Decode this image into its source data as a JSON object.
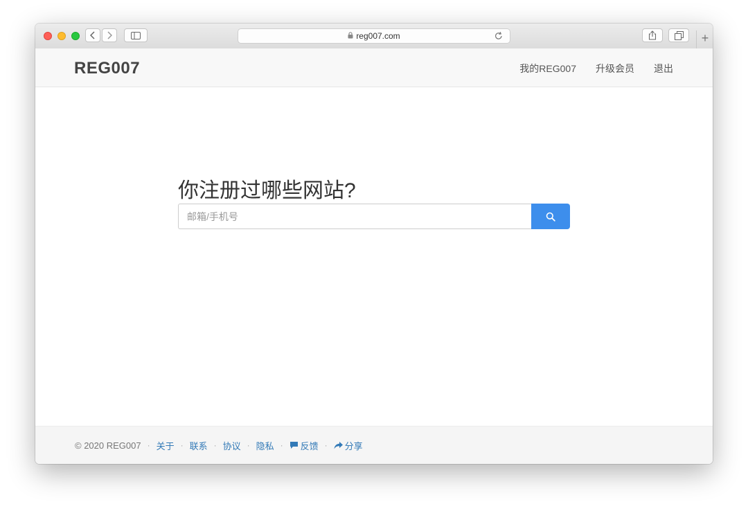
{
  "browser": {
    "url": "reg007.com",
    "icons": [
      "back-icon",
      "forward-icon",
      "sidebar-icon",
      "lock-icon",
      "reload-icon",
      "share-icon",
      "tabs-icon",
      "new-tab-icon"
    ],
    "new_tab_label": "+"
  },
  "header": {
    "logo": "REG007",
    "nav": [
      {
        "label": "我的REG007"
      },
      {
        "label": "升级会员"
      },
      {
        "label": "退出"
      }
    ]
  },
  "main": {
    "headline": "你注册过哪些网站?",
    "search": {
      "placeholder": "邮箱/手机号",
      "value": "",
      "button_icon": "search-icon"
    }
  },
  "footer": {
    "copyright": "© 2020 REG007",
    "separator": "·",
    "links": [
      {
        "label": "关于"
      },
      {
        "label": "联系"
      },
      {
        "label": "协议"
      },
      {
        "label": "隐私"
      },
      {
        "label": "反馈",
        "icon": "comment-icon"
      },
      {
        "label": "分享",
        "icon": "share-arrow-icon"
      }
    ]
  },
  "colors": {
    "accent": "#3d8eec",
    "link": "#337ab7",
    "header_bg": "#f8f8f8",
    "footer_bg": "#f5f5f5"
  }
}
